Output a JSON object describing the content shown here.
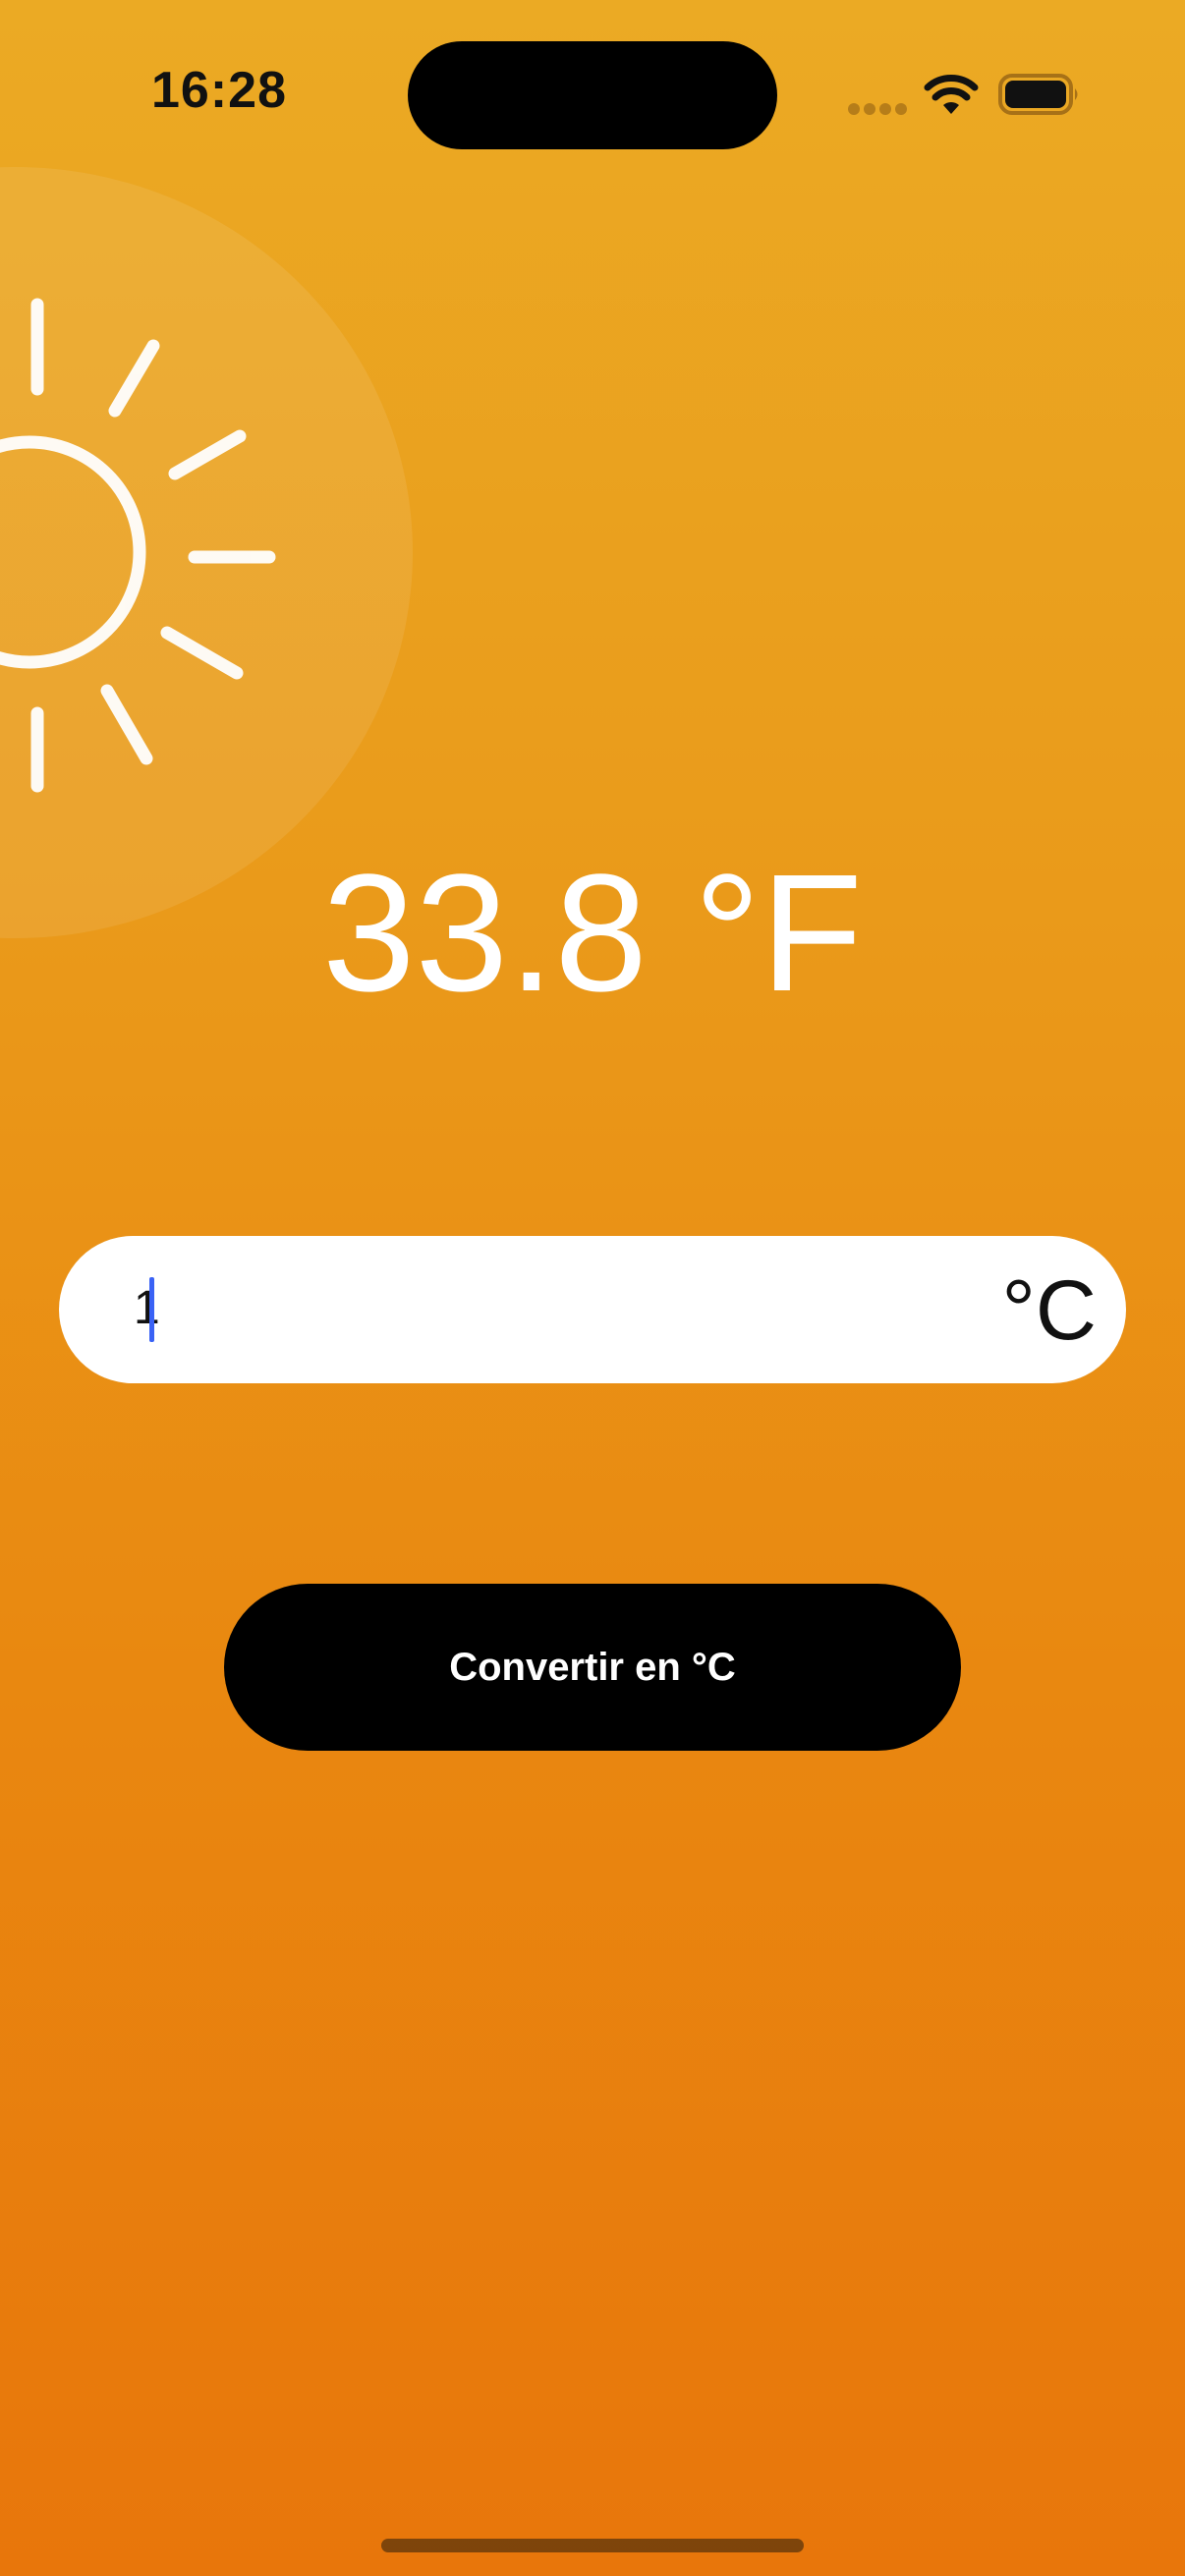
{
  "status_bar": {
    "time": "16:28",
    "icons": [
      "signal-dots-icon",
      "wifi-icon",
      "battery-icon"
    ]
  },
  "decoration": {
    "icon": "sun-icon"
  },
  "result": {
    "value": "33.8 °F"
  },
  "input": {
    "value": "1",
    "unit": "°C"
  },
  "button": {
    "label": "Convertir en °C"
  },
  "colors": {
    "background_top": "#EBAA24",
    "background_bottom": "#E8760B",
    "button": "#000000",
    "cursor": "#3A62F5",
    "text_light": "#FFFFFF"
  }
}
